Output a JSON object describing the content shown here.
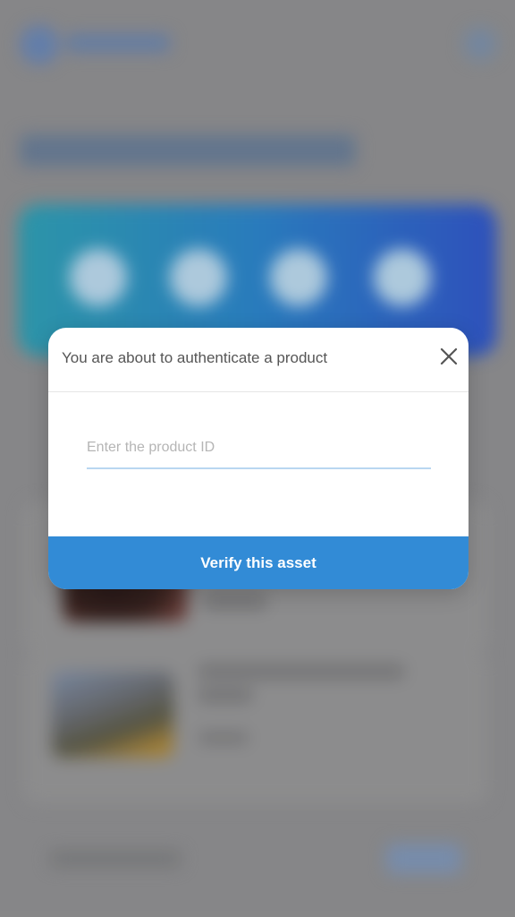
{
  "colors": {
    "backdrop": "#8f8f91",
    "modal_background": "#ffffff",
    "title_text": "#555555",
    "placeholder_text": "#b5b5b5",
    "input_underline": "#b9d7f1",
    "primary_button": "#328bd6",
    "primary_button_text": "#ffffff"
  },
  "modal": {
    "title": "You are about to authenticate a product",
    "close_icon": "close-icon",
    "product_id_input": {
      "value": "",
      "placeholder": "Enter the product ID"
    },
    "verify_button_label": "Verify this asset"
  }
}
